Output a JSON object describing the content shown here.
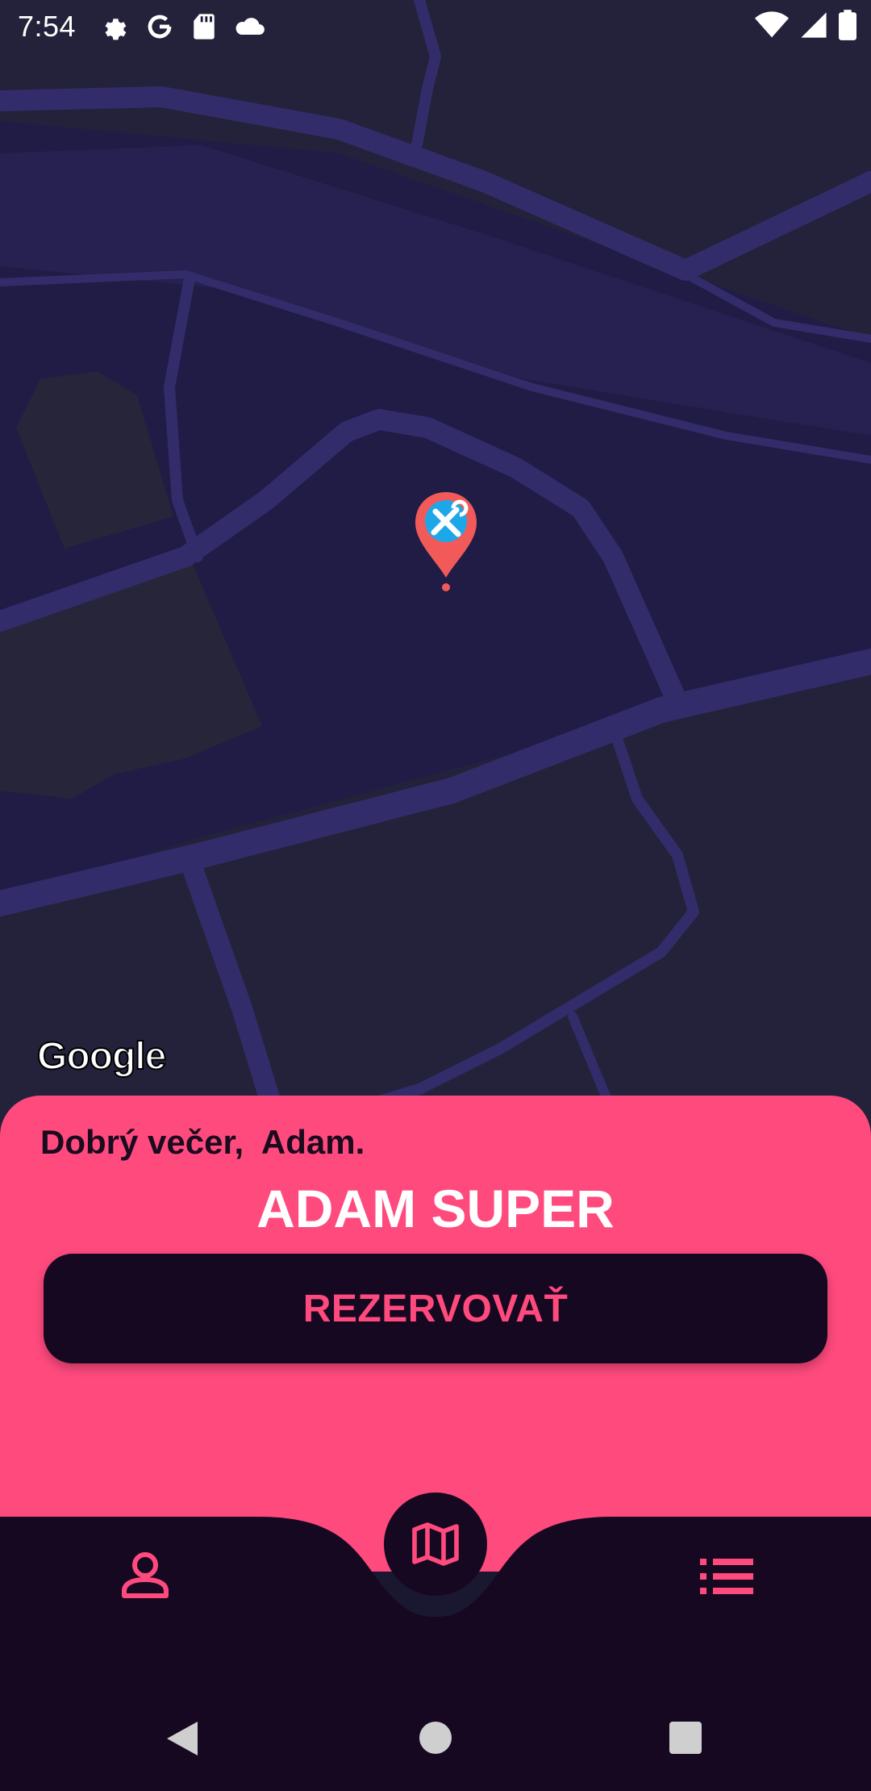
{
  "status_bar": {
    "time": "7:54",
    "left_icons": [
      "gear-icon",
      "google-g-icon",
      "sd-card-icon",
      "cloud-icon"
    ],
    "right_icons": [
      "wifi-icon",
      "cell-signal-icon",
      "battery-icon"
    ]
  },
  "map": {
    "attribution": "Google",
    "marker_icon": "tools-pin-icon"
  },
  "card": {
    "greeting": "Dobrý večer,  Adam.",
    "name": "ADAM SUPER",
    "reserve_label": "REZERVOVAŤ"
  },
  "bottom_nav": {
    "items": [
      {
        "name": "profile",
        "icon": "person-icon"
      },
      {
        "name": "map",
        "icon": "map-icon",
        "active": true
      },
      {
        "name": "list",
        "icon": "list-icon"
      }
    ]
  },
  "colors": {
    "accent": "#ff4a7e",
    "dark": "#170821",
    "map_bg": "#221f45",
    "road": "#3a3272"
  }
}
